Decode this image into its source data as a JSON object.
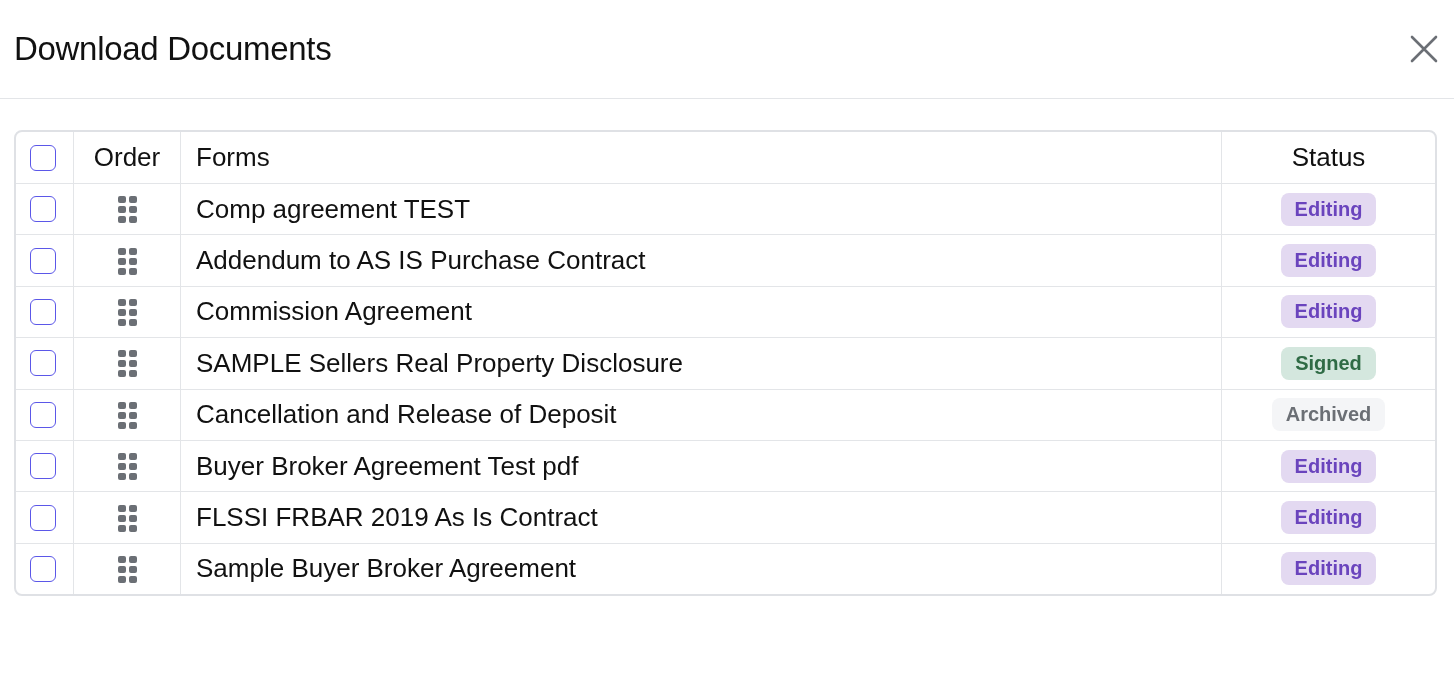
{
  "dialog": {
    "title": "Download Documents"
  },
  "table": {
    "select_all": {
      "checked": false
    },
    "columns": [
      "Order",
      "Forms",
      "Status"
    ],
    "rows": [
      {
        "checked": false,
        "form": "Comp agreement TEST",
        "status": {
          "label": "Editing",
          "kind": "editing"
        }
      },
      {
        "checked": false,
        "form": "Addendum to AS IS Purchase Contract",
        "status": {
          "label": "Editing",
          "kind": "editing"
        }
      },
      {
        "checked": false,
        "form": "Commission Agreement",
        "status": {
          "label": "Editing",
          "kind": "editing"
        }
      },
      {
        "checked": false,
        "form": "SAMPLE Sellers Real Property Disclosure",
        "status": {
          "label": "Signed",
          "kind": "signed"
        }
      },
      {
        "checked": false,
        "form": "Cancellation and Release of Deposit",
        "status": {
          "label": "Archived",
          "kind": "archived"
        }
      },
      {
        "checked": false,
        "form": "Buyer Broker Agreement Test pdf",
        "status": {
          "label": "Editing",
          "kind": "editing"
        }
      },
      {
        "checked": false,
        "form": "FLSSI FRBAR 2019 As Is Contract",
        "status": {
          "label": "Editing",
          "kind": "editing"
        }
      },
      {
        "checked": false,
        "form": "Sample Buyer Broker Agreement",
        "status": {
          "label": "Editing",
          "kind": "editing"
        }
      }
    ]
  }
}
